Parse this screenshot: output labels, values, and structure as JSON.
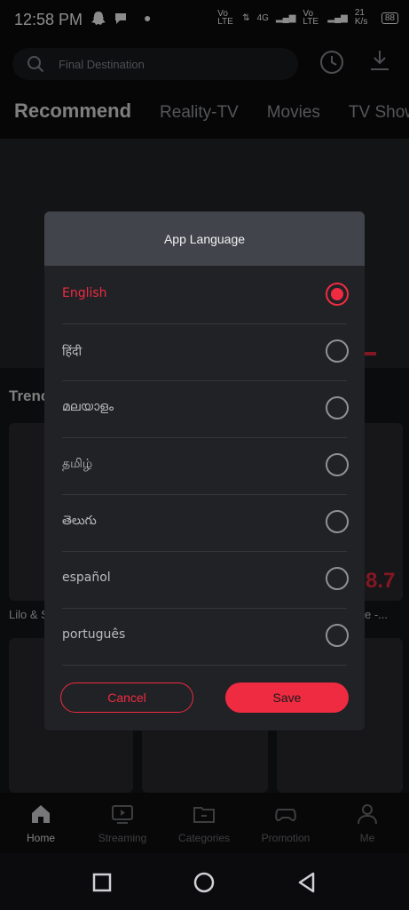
{
  "status": {
    "time": "12:58 PM",
    "net1": "Vo LTE",
    "net2": "4G",
    "net3": "Vo LTE",
    "speed": "21 K/s",
    "battery": "88"
  },
  "search": {
    "placeholder": "Final Destination"
  },
  "tabs": [
    "Recommend",
    "Reality-TV",
    "Movies",
    "TV Shows"
  ],
  "background": {
    "section_title": "Trenc",
    "caption_left": "Lilo & S",
    "caption_right": "ible -...",
    "score": "8.7"
  },
  "dialog": {
    "title": "App Language",
    "options": [
      {
        "label": "English",
        "selected": true
      },
      {
        "label": "हिंदी",
        "selected": false
      },
      {
        "label": "മലയാളം",
        "selected": false
      },
      {
        "label": "தமிழ்",
        "selected": false
      },
      {
        "label": "తెలుగు",
        "selected": false
      },
      {
        "label": "español",
        "selected": false
      },
      {
        "label": "português",
        "selected": false
      }
    ],
    "cancel_label": "Cancel",
    "save_label": "Save"
  },
  "bottom_nav": [
    {
      "label": "Home",
      "icon": "home-icon",
      "active": true
    },
    {
      "label": "Streaming",
      "icon": "streaming-icon",
      "active": false
    },
    {
      "label": "Categories",
      "icon": "categories-icon",
      "active": false
    },
    {
      "label": "Promotion",
      "icon": "gamepad-icon",
      "active": false
    },
    {
      "label": "Me",
      "icon": "profile-icon",
      "active": false
    }
  ],
  "colors": {
    "accent": "#ef2b41",
    "dialog_bg": "#212226",
    "dialog_header": "#41454b"
  }
}
